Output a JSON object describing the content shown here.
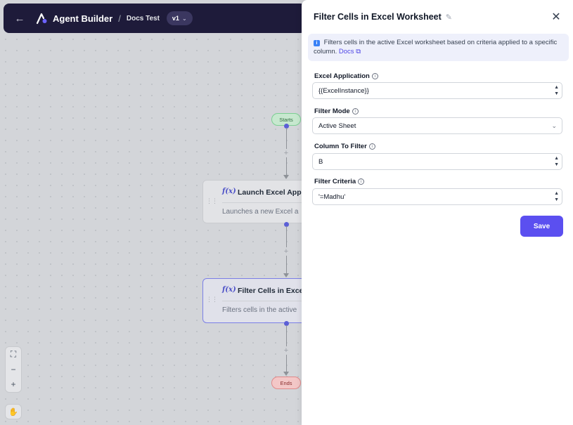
{
  "topbar": {
    "app_name": "Agent Builder",
    "separator": "/",
    "breadcrumb": "Docs Test",
    "version": "v1"
  },
  "flow": {
    "start_label": "Starts",
    "end_label": "Ends",
    "nodes": [
      {
        "title": "Launch Excel Appl",
        "description": "Launches a new Excel a",
        "selected": false
      },
      {
        "title": "Filter Cells in Excel",
        "description": "Filters cells in the active",
        "selected": true
      }
    ]
  },
  "panel": {
    "title": "Filter Cells in Excel Worksheet",
    "info_text": "Filters cells in the active Excel worksheet based on criteria applied to a specific column.",
    "docs_label": "Docs",
    "fields": [
      {
        "label": "Excel Application",
        "value": "{{ExcelInstance}}",
        "kind": "text-stepper"
      },
      {
        "label": "Filter Mode",
        "value": "Active Sheet",
        "kind": "select"
      },
      {
        "label": "Column To Filter",
        "value": "B",
        "kind": "text-stepper"
      },
      {
        "label": "Filter Criteria",
        "value": "'=Madhu'",
        "kind": "text-stepper"
      }
    ],
    "save_label": "Save"
  },
  "colors": {
    "accent": "#5b4ff0",
    "topbar_bg": "#1e1b3a",
    "start_bg": "#c7e8cf",
    "end_bg": "#f3c7c7"
  }
}
